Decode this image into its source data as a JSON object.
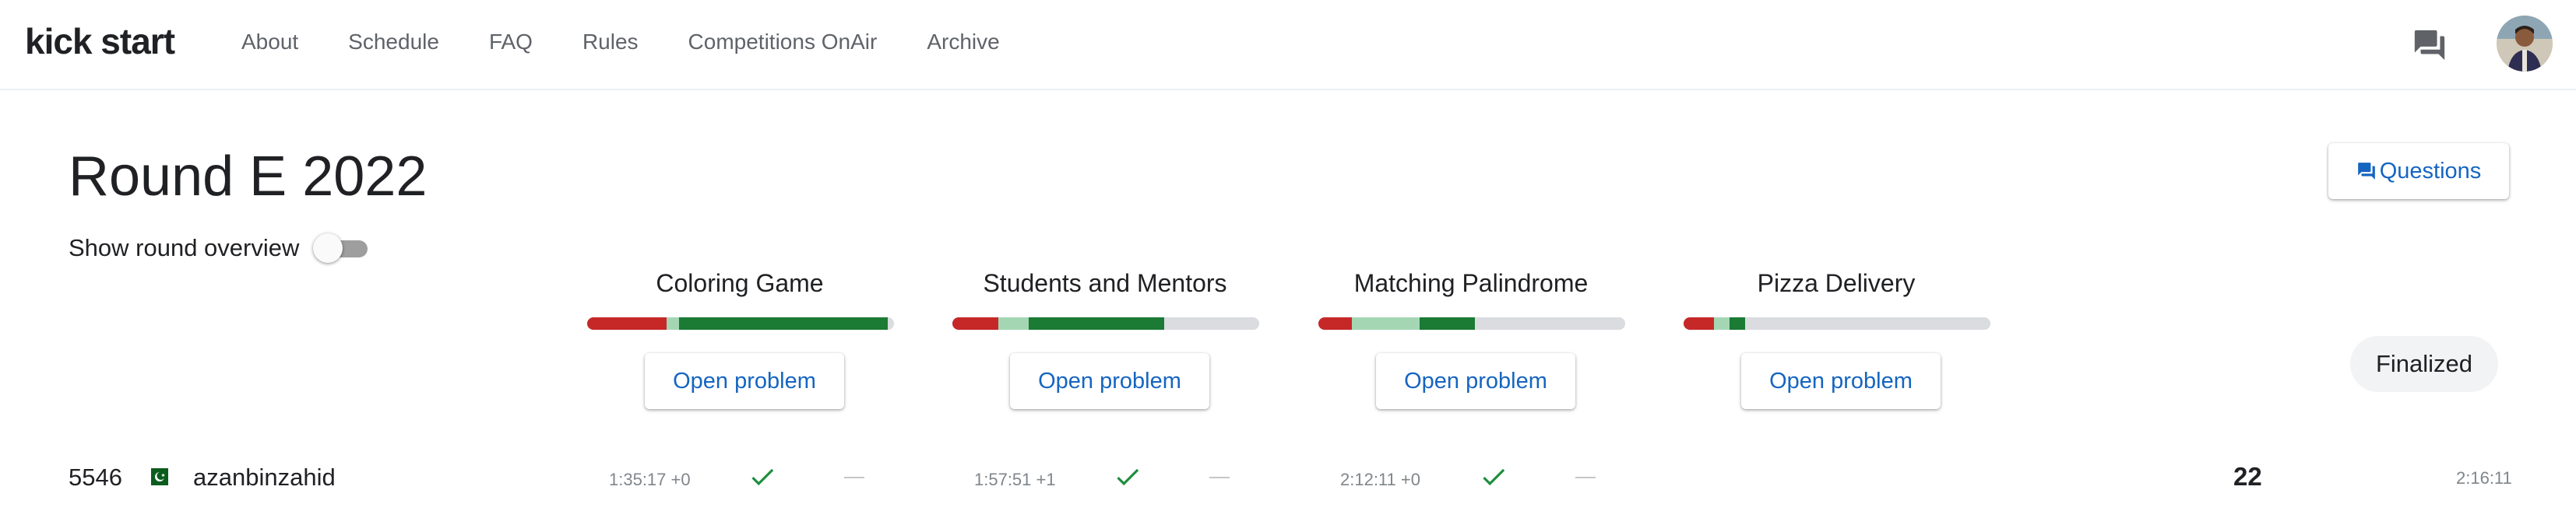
{
  "brand": {
    "logo": "kick start"
  },
  "nav": [
    {
      "label": "About"
    },
    {
      "label": "Schedule"
    },
    {
      "label": "FAQ"
    },
    {
      "label": "Rules"
    },
    {
      "label": "Competitions OnAir"
    },
    {
      "label": "Archive"
    }
  ],
  "header": {
    "title": "Round E 2022",
    "overview_label": "Show round overview",
    "overview_enabled": false,
    "questions_label": "Questions"
  },
  "colors": {
    "wrong": "#c62828",
    "partial": "#a5d6b4",
    "solved": "#1b7a34",
    "unattempted": "#dadce0",
    "link": "#1565c0"
  },
  "problems": [
    {
      "title": "Coloring Game",
      "button": "Open problem",
      "stats_fraction": {
        "wrong": 0.26,
        "partial": 0.04,
        "solved": 0.68,
        "unattempted": 0.02
      }
    },
    {
      "title": "Students and Mentors",
      "button": "Open problem",
      "stats_fraction": {
        "wrong": 0.15,
        "partial": 0.1,
        "solved": 0.44,
        "unattempted": 0.31
      }
    },
    {
      "title": "Matching Palindrome",
      "button": "Open problem",
      "stats_fraction": {
        "wrong": 0.11,
        "partial": 0.22,
        "solved": 0.18,
        "unattempted": 0.49
      }
    },
    {
      "title": "Pizza Delivery",
      "button": "Open problem",
      "stats_fraction": {
        "wrong": 0.1,
        "partial": 0.05,
        "solved": 0.05,
        "unattempted": 0.8
      }
    }
  ],
  "status": {
    "label": "Finalized"
  },
  "row": {
    "rank": "5546",
    "flag_icon": "pakistan-flag-icon",
    "username": "azanbinzahid",
    "attempts": [
      {
        "time": "1:35:17 +0",
        "solved": true
      },
      {
        "time": "1:57:51 +1",
        "solved": true
      },
      {
        "time": "2:12:11 +0",
        "solved": true
      }
    ],
    "score": "22",
    "penalty_time": "2:16:11"
  }
}
